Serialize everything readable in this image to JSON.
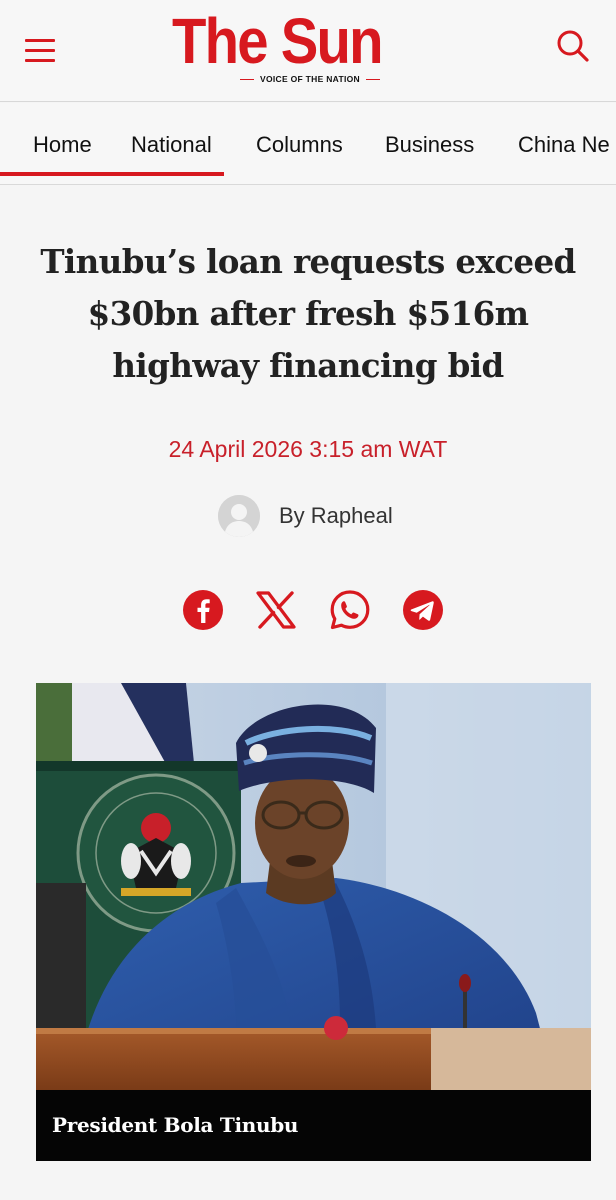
{
  "header": {
    "logo_text": "The Sun",
    "logo_tagline": "VOICE OF THE NATION",
    "brand_color": "#d7191f",
    "menu_icon": "hamburger-menu-icon",
    "search_icon": "search-icon"
  },
  "nav": {
    "items": [
      {
        "label": "Home",
        "active": false
      },
      {
        "label": "National",
        "active": true
      },
      {
        "label": "Columns",
        "active": false
      },
      {
        "label": "Business",
        "active": false
      },
      {
        "label": "China Ne",
        "active": false
      }
    ]
  },
  "article": {
    "headline": "Tinubu’s loan requests exceed $30bn after fresh $516m highway financing bid",
    "date": "24 April 2026 3:15 am WAT",
    "date_color": "#c8202a",
    "author_text": "By Rapheal",
    "author_avatar_icon": "default-avatar-icon"
  },
  "share": {
    "color": "#d7191f",
    "icons": [
      "facebook-icon",
      "x-icon",
      "whatsapp-icon",
      "telegram-icon"
    ]
  },
  "figure": {
    "caption": "President Bola Tinubu"
  }
}
